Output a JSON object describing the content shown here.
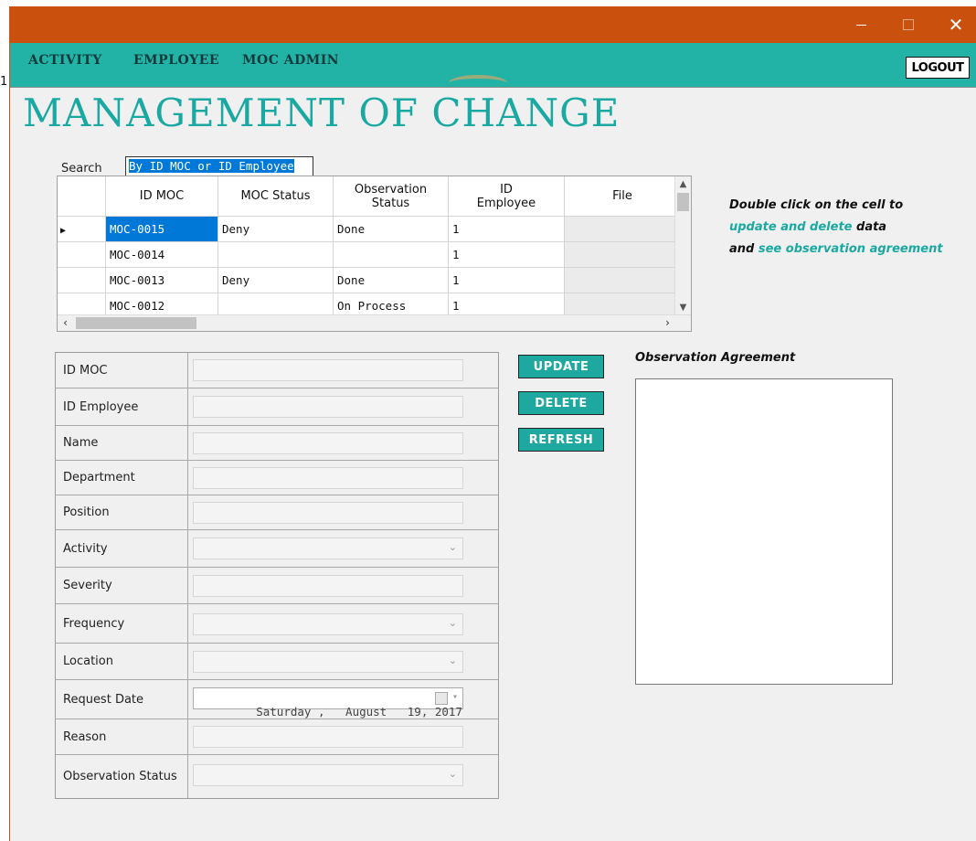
{
  "window": {
    "minimize": "—",
    "close": "✕"
  },
  "menu": {
    "items": [
      "ACTIVITY",
      "EMPLOYEE",
      "MOC ADMIN"
    ],
    "logout": "LOGOUT"
  },
  "page_title": "MANAGEMENT OF CHANGE",
  "search": {
    "label": "Search",
    "value": "By ID MOC or ID Employee"
  },
  "grid": {
    "columns": [
      "ID MOC",
      "MOC Status",
      "Observation Status",
      "ID Employee",
      "File"
    ],
    "column_lines": [
      [
        "ID MOC"
      ],
      [
        "MOC Status"
      ],
      [
        "Observation",
        "Status"
      ],
      [
        "ID",
        "Employee"
      ],
      [
        "File"
      ]
    ],
    "rows": [
      [
        "MOC-0015",
        "Deny",
        "Done",
        "1",
        ""
      ],
      [
        "MOC-0014",
        "",
        "",
        "1",
        ""
      ],
      [
        "MOC-0013",
        "Deny",
        "Done",
        "1",
        ""
      ],
      [
        "MOC-0012",
        "",
        "On Process",
        "1",
        ""
      ]
    ],
    "current_row_marker": "▶"
  },
  "hint": {
    "line1": "Double click on the cell to",
    "line2_a": "update and delete",
    "line2_b": " data",
    "line3_a": "and ",
    "line3_b": "see observation agreement"
  },
  "form": {
    "fields": [
      {
        "label": "ID MOC",
        "type": "text",
        "value": ""
      },
      {
        "label": "ID Employee",
        "type": "text",
        "value": ""
      },
      {
        "label": "Name",
        "type": "text",
        "value": ""
      },
      {
        "label": "Department",
        "type": "text",
        "value": ""
      },
      {
        "label": "Position",
        "type": "text",
        "value": ""
      },
      {
        "label": "Activity",
        "type": "select",
        "value": ""
      },
      {
        "label": "Severity",
        "type": "text",
        "value": ""
      },
      {
        "label": "Frequency",
        "type": "select",
        "value": ""
      },
      {
        "label": "Location",
        "type": "select",
        "value": ""
      },
      {
        "label": "Request Date",
        "type": "date",
        "value": "Saturday ,   August   19, 2017"
      },
      {
        "label": "Reason",
        "type": "text",
        "value": ""
      },
      {
        "label": "Observation Status",
        "type": "select",
        "value": ""
      }
    ]
  },
  "buttons": {
    "update": "UPDATE",
    "delete": "DELETE",
    "refresh": "REFRESH"
  },
  "observation": {
    "title": "Observation Agreement",
    "text": ""
  },
  "edge_char": "1",
  "colors": {
    "titlebar": "#c9500d",
    "menubar": "#22b3a6",
    "accent": "#1aa9a2",
    "selection": "#0078d7"
  }
}
